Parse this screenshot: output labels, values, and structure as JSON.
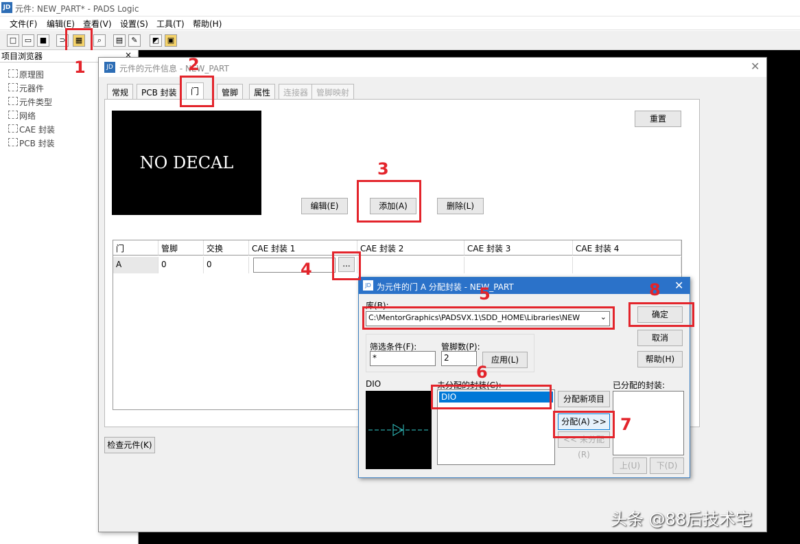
{
  "app": {
    "title": "元件: NEW_PART* - PADS Logic",
    "icon": "JD"
  },
  "menu": [
    "文件(F)",
    "编辑(E)",
    "查看(V)",
    "设置(S)",
    "工具(T)",
    "帮助(H)"
  ],
  "left_panel": {
    "title": "项目浏览器",
    "close": "×",
    "items": [
      "原理图",
      "元器件",
      "元件类型",
      "网络",
      "CAE 封装",
      "PCB 封装"
    ]
  },
  "dialog": {
    "title": "元件的元件信息 - NEW_PART",
    "tabs": [
      "常规",
      "PCB 封装",
      "门",
      "管脚",
      "属性",
      "连接器",
      "管脚映射"
    ],
    "preview_text": "NO DECAL",
    "reset": "重置",
    "edit": "编辑(E)",
    "add": "添加(A)",
    "delete": "删除(L)",
    "grid_headers": [
      "门",
      "管脚",
      "交换",
      "CAE 封装 1",
      "CAE 封装 2",
      "CAE 封装 3",
      "CAE 封装 4"
    ],
    "row": {
      "gate": "A",
      "pins": "0",
      "swap": "0"
    },
    "browse": "...",
    "check": "检查元件(K)"
  },
  "sub_dialog": {
    "title": "为元件的门 A 分配封装 - NEW_PART",
    "library_label": "库(B):",
    "library_value": "C:\\MentorGraphics\\PADSVX.1\\SDD_HOME\\Libraries\\NEW",
    "filter_label": "筛选条件(F):",
    "filter_value": "*",
    "pin_count_label": "管脚数(P):",
    "pin_count_value": "2",
    "apply": "应用(L)",
    "preview_label": "DIO",
    "unassigned_label": "未分配的封装(C):",
    "unassigned_items": [
      "DIO"
    ],
    "assign_new": "分配新项目",
    "assign": "分配(A) >>",
    "unassign": "<< 未分配(R)",
    "assigned_label": "已分配的封装:",
    "ok": "确定",
    "cancel": "取消",
    "help": "帮助(H)",
    "up": "上(U)",
    "down": "下(D)"
  },
  "annotations": [
    "1",
    "2",
    "3",
    "4",
    "5",
    "6",
    "7",
    "8"
  ],
  "watermark": "头条 @88后技术宅",
  "colors": {
    "annotation": "#e3242b",
    "selection": "#0078d7",
    "title_active": "#2b72c9"
  }
}
